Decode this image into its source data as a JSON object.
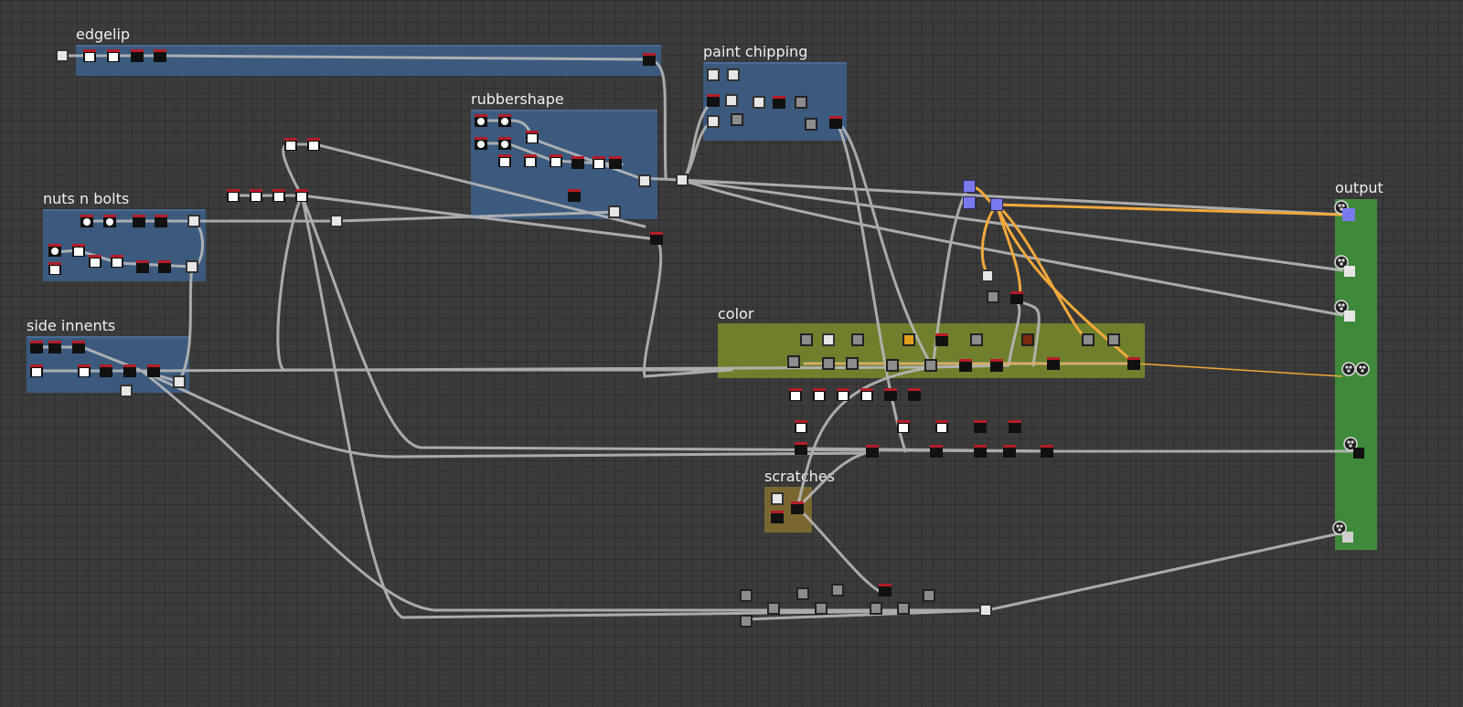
{
  "frames": {
    "edgelip": "edgelip",
    "rubbershape": "rubbershape",
    "paint_chipping": "paint chipping",
    "nuts_n_bolts": "nuts n bolts",
    "side_innents": "side innents",
    "color": "color",
    "scratches": "scratches",
    "output": "output"
  },
  "colors": {
    "canvas_bg": "#3b3b3b",
    "frame_blue": "#3b5a7e",
    "frame_olive": "#6f7f2c",
    "frame_brown": "#7a6730",
    "frame_output": "#3e8a3a",
    "wire_gray": "#b8b8b8",
    "wire_orange": "#f2a93b",
    "node_header_red": "#b51c28",
    "node_purple": "#7a7aef"
  },
  "icons": {
    "output_port": "output-gear-icon",
    "node": "node-thumbnail-icon"
  }
}
